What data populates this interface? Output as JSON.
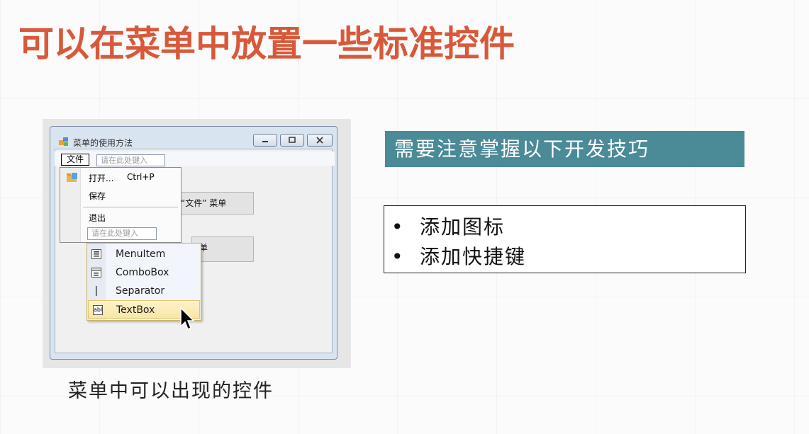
{
  "slide": {
    "title": "可以在菜单中放置一些标准控件",
    "caption": "菜单中可以出现的控件"
  },
  "window": {
    "title": "菜单的使用方法",
    "menubar": {
      "file_label": "文件",
      "type_here": "请在此处键入"
    },
    "buttons": [
      {
        "label": "“文件” 菜单"
      },
      {
        "label": "单"
      }
    ],
    "dropdown": {
      "items": [
        {
          "label": "打开...",
          "shortcut": "Ctrl+P"
        },
        {
          "label": "保存"
        },
        {
          "label": "退出"
        }
      ],
      "type_here": "请在此处键入"
    },
    "popup": {
      "items": [
        {
          "label": "MenuItem",
          "icon": "menuitem-icon"
        },
        {
          "label": "ComboBox",
          "icon": "combobox-icon"
        },
        {
          "label": "Separator",
          "icon": "separator-icon"
        },
        {
          "label": "TextBox",
          "icon": "textbox-icon",
          "icon_text": "abl",
          "highlighted": true
        }
      ]
    }
  },
  "tips": {
    "header": "需要注意掌握以下开发技巧",
    "bullets": [
      "添加图标",
      "添加快捷键"
    ],
    "bullet_symbol": "•"
  },
  "colors": {
    "title": "#d8593a",
    "tip_header_bg": "#4b8a97",
    "highlight": "#f9e6a4"
  }
}
